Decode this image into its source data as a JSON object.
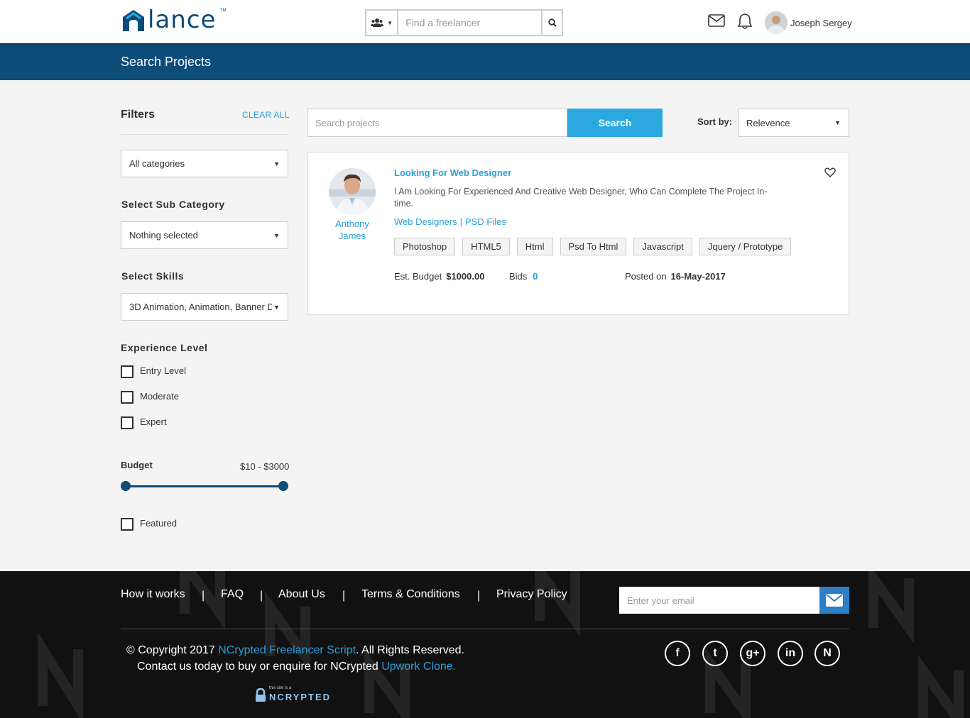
{
  "header": {
    "logo_text": "lance",
    "logo_tm": "TM",
    "search_placeholder": "Find a freelancer",
    "user_name": "Joseph Sergey"
  },
  "banner": {
    "title": "Search Projects"
  },
  "filters": {
    "title": "Filters",
    "clear_all": "CLEAR ALL",
    "category": "All categories",
    "sub_category_label": "Select Sub Category",
    "sub_category_value": "Nothing selected",
    "skills_label": "Select Skills",
    "skills_value": "3D Animation, Animation, Banner D",
    "experience_label": "Experience Level",
    "experience_options": [
      "Entry Level",
      "Moderate",
      "Expert"
    ],
    "budget_label": "Budget",
    "budget_range": "$10 - $3000",
    "budget_min_fraction": 0,
    "budget_max_fraction": 1,
    "featured_label": "Featured"
  },
  "search": {
    "placeholder": "Search projects",
    "button": "Search",
    "sort_label": "Sort by:",
    "sort_value": "Relevence"
  },
  "project": {
    "client_first": "Anthony",
    "client_last": "James",
    "title": "Looking For Web Designer",
    "description": "I Am Looking For Experienced And Creative Web Designer, Who Can Complete The Project In-time.",
    "category": "Web Designers",
    "sub_category": "PSD Files",
    "category_separator": "|",
    "tags": [
      "Photoshop",
      "HTML5",
      "Html",
      "Psd To Html",
      "Javascript",
      "Jquery / Prototype"
    ],
    "budget_label": "Est. Budget",
    "budget_value": "$1000.00",
    "bids_label": "Bids",
    "bids_value": "0",
    "posted_label": "Posted on",
    "posted_value": "16-May-2017"
  },
  "footer": {
    "nav": [
      "How it works",
      "FAQ",
      "About Us",
      "Terms & Conditions",
      "Privacy Policy"
    ],
    "nav_separator": "|",
    "email_placeholder": "Enter your email",
    "copyright_prefix": "© Copyright 2017 ",
    "copyright_link": "NCrypted Freelancer Script",
    "copyright_suffix": ". All Rights Reserved.",
    "contact_prefix": "Contact us today to buy or enquire for NCrypted ",
    "contact_link": "Upwork Clone.",
    "badge_small": "this site is a",
    "badge_text": "NCRYPTED",
    "social": [
      "facebook",
      "twitter",
      "google-plus",
      "linkedin",
      "ncrypted"
    ],
    "social_glyphs": [
      "f",
      "t",
      "g+",
      "in",
      "N"
    ]
  },
  "colors": {
    "brand_dark": "#0e4c79",
    "accent": "#2ba8e0",
    "link": "#2a9fd8",
    "footer_bg": "#111111"
  }
}
